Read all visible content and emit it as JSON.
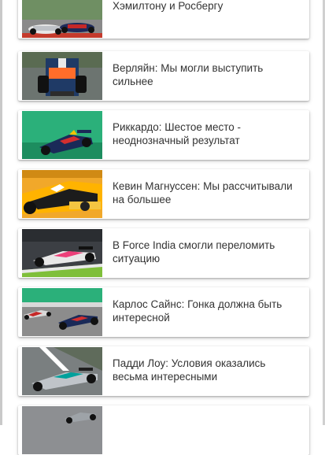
{
  "news": {
    "items": [
      {
        "title": "Хэмилтону и Росбергу",
        "thumb": "f1-cars-on-track-photo"
      },
      {
        "title": "Верляйн: Мы могли выступить сильнее",
        "thumb": "manor-f1-car-photo"
      },
      {
        "title": "Риккардо: Шестое место - неоднозначный результат",
        "thumb": "red-bull-f1-car-photo"
      },
      {
        "title": "Кевин Магнуссен: Мы рассчитывали на большее",
        "thumb": "renault-f1-car-photo"
      },
      {
        "title": "В Force India смогли переломить ситуацию",
        "thumb": "force-india-f1-car-photo"
      },
      {
        "title": "Карлос Сайнс: Гонка должна быть интересной",
        "thumb": "toro-rosso-f1-car-photo"
      },
      {
        "title": "Падди Лоу: Условия оказались весьма интересными",
        "thumb": "mercedes-f1-car-photo"
      },
      {
        "title": "",
        "thumb": "f1-car-photo"
      }
    ]
  },
  "colors": {
    "accent": "#8bc34a",
    "title_text": "#333333",
    "card_bg": "#ffffff"
  }
}
